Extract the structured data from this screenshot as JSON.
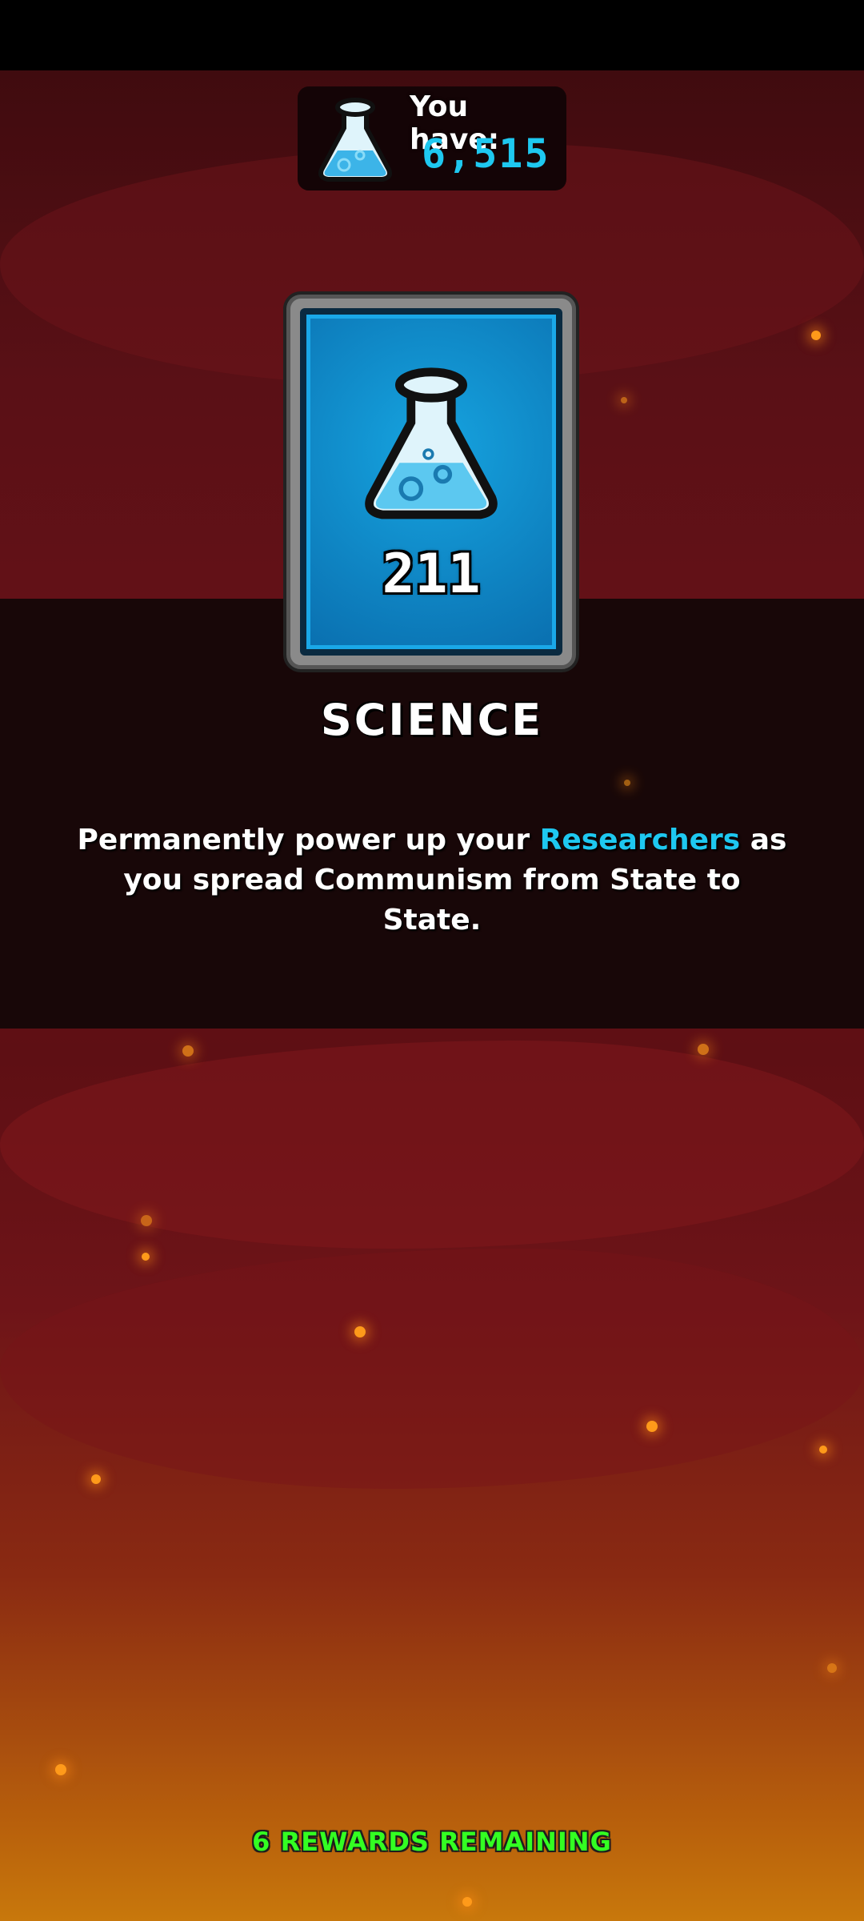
{
  "currency": {
    "label": "You have:",
    "amount": "6,515",
    "icon": "science-flask-icon"
  },
  "reward_card": {
    "count": "211",
    "icon": "science-flask-icon",
    "accent": "#1aa8e8"
  },
  "reward_title": "SCIENCE",
  "description": {
    "before": "Permanently power up your ",
    "highlight": "Researchers",
    "after": " as you spread Communism from State to State."
  },
  "footer": {
    "rewards_remaining": "6 REWARDS REMAINING"
  }
}
